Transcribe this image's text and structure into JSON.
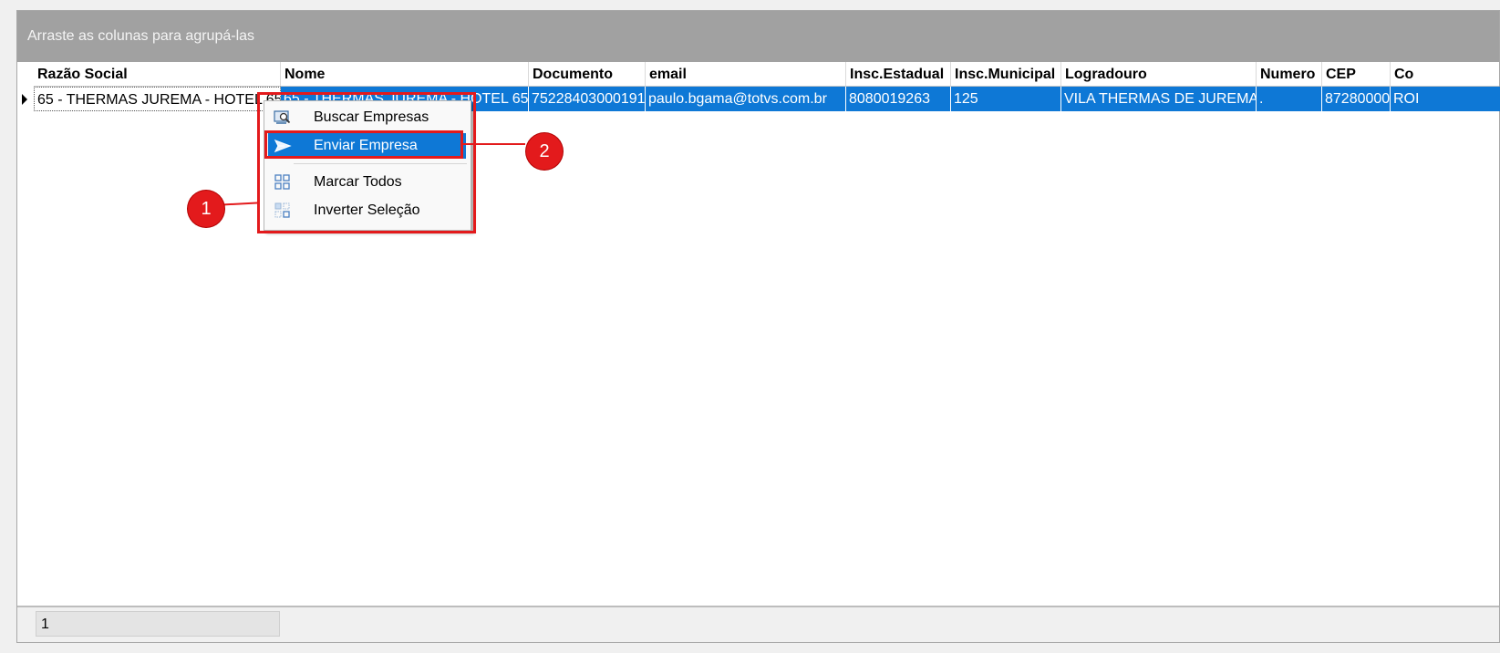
{
  "grid": {
    "group_panel_text": "Arraste as colunas para agrupá-las",
    "columns": [
      "Razão Social",
      "Nome",
      "Documento",
      "email",
      "Insc.Estadual",
      "Insc.Municipal",
      "Logradouro",
      "Numero",
      "CEP",
      "Co"
    ],
    "rows": [
      [
        "65 - THERMAS JUREMA - HOTEL 65",
        "65 - THERMAS JUREMA - HOTEL 65",
        "75228403000191",
        "paulo.bgama@totvs.com.br",
        "8080019263",
        "125",
        "VILA THERMAS DE JUREMA",
        ".",
        "87280000",
        "ROI"
      ]
    ],
    "selection_color": "#0e78d6"
  },
  "status": {
    "record_count": "1"
  },
  "context_menu": {
    "items": [
      {
        "label": "Buscar Empresas",
        "icon": "search-company-icon"
      },
      {
        "label": "Enviar Empresa",
        "icon": "send-icon",
        "highlighted": true
      },
      {
        "label": "Marcar Todos",
        "icon": "grid-check-icon"
      },
      {
        "label": "Inverter Seleção",
        "icon": "invert-selection-icon"
      }
    ]
  },
  "annotations": {
    "marker_1": "1",
    "marker_2": "2",
    "color": "#e31a1c"
  }
}
